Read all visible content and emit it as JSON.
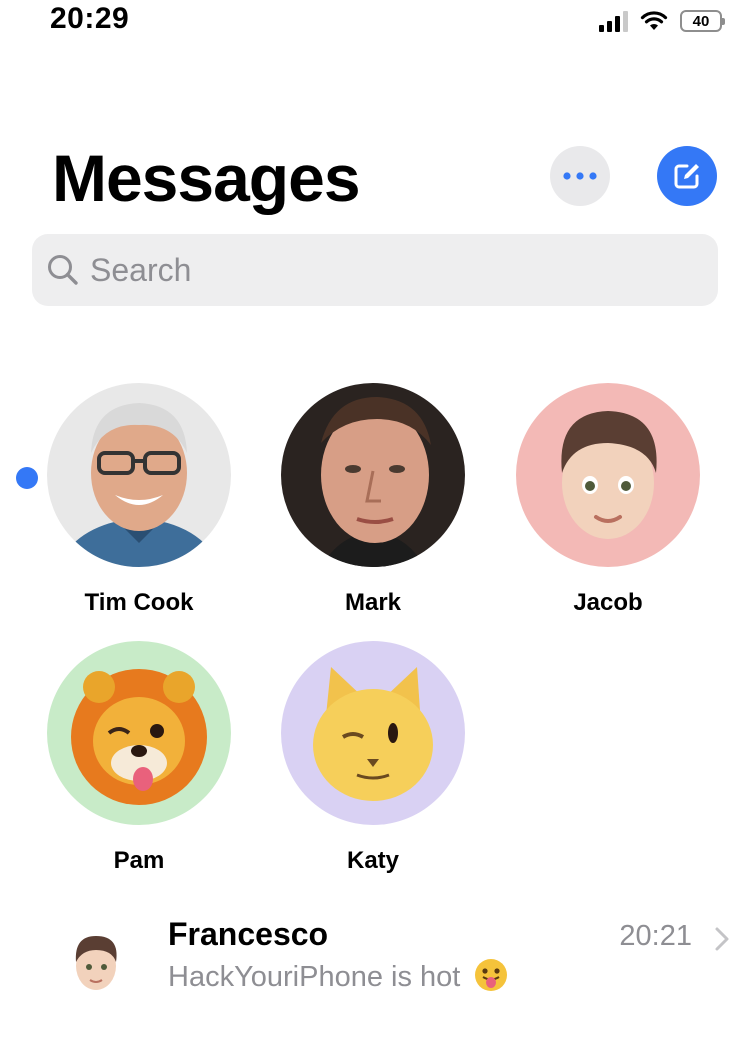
{
  "status_bar": {
    "time": "20:29",
    "battery": "40",
    "icons": [
      "cellular-signal-icon",
      "wifi-icon",
      "battery-icon"
    ]
  },
  "header": {
    "title": "Messages",
    "more_icon": "ellipsis-icon",
    "compose_icon": "compose-icon"
  },
  "search": {
    "placeholder": "Search",
    "value": ""
  },
  "pinned": [
    {
      "name": "Tim Cook",
      "unread": true
    },
    {
      "name": "Mark",
      "unread": false
    },
    {
      "name": "Jacob",
      "unread": false
    },
    {
      "name": "Pam",
      "unread": false
    },
    {
      "name": "Katy",
      "unread": false
    }
  ],
  "conversations": [
    {
      "name": "Francesco",
      "time": "20:21",
      "preview": "HackYouriPhone is hot",
      "preview_emoji": "face-with-tongue"
    }
  ],
  "colors": {
    "accent": "#3478f6",
    "secondary_text": "#8e8e93",
    "search_bg": "#eeeeef",
    "jacob_bg": "#f3b9b6",
    "pam_bg": "#c8ebc8",
    "katy_bg": "#d9d1f3"
  }
}
